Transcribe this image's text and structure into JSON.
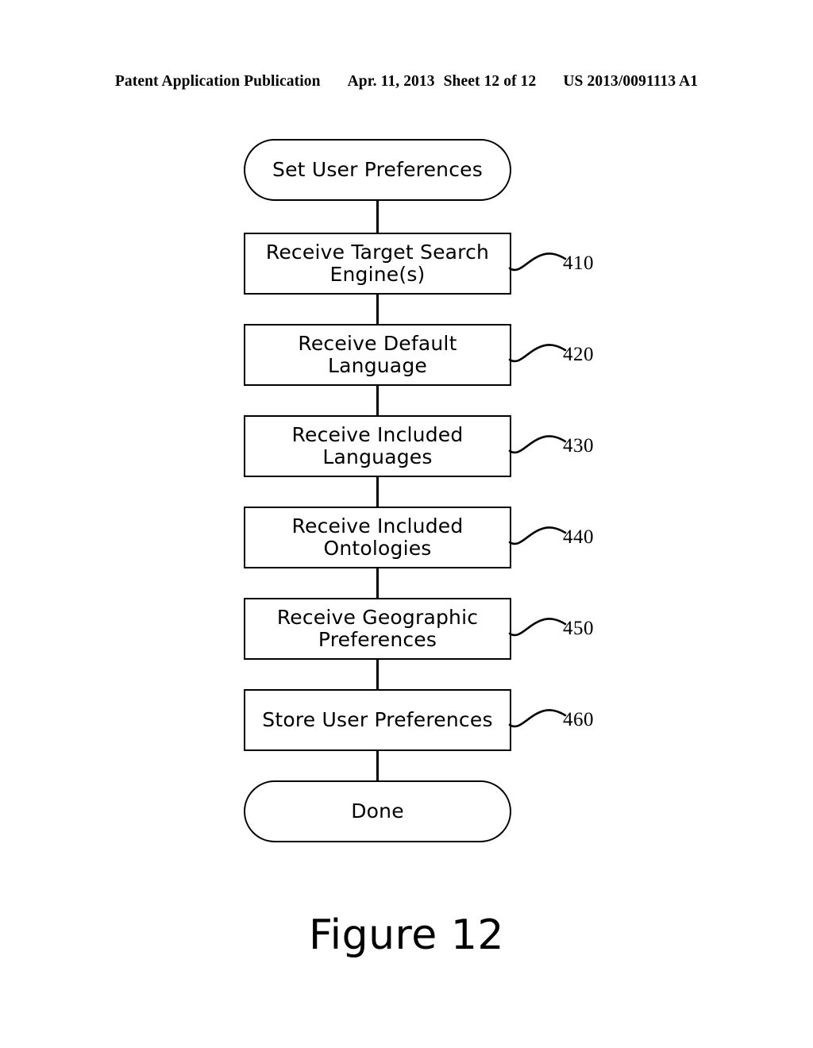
{
  "header": {
    "publication": "Patent Application Publication",
    "date": "Apr. 11, 2013",
    "sheet": "Sheet 12 of 12",
    "pub_number": "US 2013/0091113 A1"
  },
  "caption": "Figure 12",
  "colors": {
    "ink": "#000000",
    "paper": "#ffffff"
  },
  "chart_data": {
    "type": "diagram",
    "diagram_type": "flowchart",
    "title": "Figure 12",
    "orientation": "top-to-bottom",
    "nodes": [
      {
        "id": "start",
        "shape": "terminal",
        "label": "Set User Preferences",
        "ref": ""
      },
      {
        "id": "410",
        "shape": "process",
        "label": "Receive Target Search Engine(s)",
        "ref": "410"
      },
      {
        "id": "420",
        "shape": "process",
        "label": "Receive Default Language",
        "ref": "420"
      },
      {
        "id": "430",
        "shape": "process",
        "label": "Receive Included Languages",
        "ref": "430"
      },
      {
        "id": "440",
        "shape": "process",
        "label": "Receive Included Ontologies",
        "ref": "440"
      },
      {
        "id": "450",
        "shape": "process",
        "label": "Receive Geographic Preferences",
        "ref": "450"
      },
      {
        "id": "460",
        "shape": "process",
        "label": "Store User Preferences",
        "ref": "460"
      },
      {
        "id": "done",
        "shape": "terminal",
        "label": "Done",
        "ref": ""
      }
    ],
    "edges": [
      {
        "from": "start",
        "to": "410"
      },
      {
        "from": "410",
        "to": "420"
      },
      {
        "from": "420",
        "to": "430"
      },
      {
        "from": "430",
        "to": "440"
      },
      {
        "from": "440",
        "to": "450"
      },
      {
        "from": "450",
        "to": "460"
      },
      {
        "from": "460",
        "to": "done"
      }
    ],
    "reference_numerals": [
      "410",
      "420",
      "430",
      "440",
      "450",
      "460"
    ]
  },
  "nodes": {
    "n0": {
      "label": "Set User Preferences"
    },
    "n1": {
      "label": "Receive Target Search Engine(s)",
      "line1": "Receive Target Search",
      "line2": "Engine(s)",
      "ref": "410"
    },
    "n2": {
      "label": "Receive Default Language",
      "line1": "Receive Default",
      "line2": "Language",
      "ref": "420"
    },
    "n3": {
      "label": "Receive Included Languages",
      "line1": "Receive Included",
      "line2": "Languages",
      "ref": "430"
    },
    "n4": {
      "label": "Receive Included Ontologies",
      "line1": "Receive Included",
      "line2": "Ontologies",
      "ref": "440"
    },
    "n5": {
      "label": "Receive Geographic Preferences",
      "line1": "Receive Geographic",
      "line2": "Preferences",
      "ref": "450"
    },
    "n6": {
      "label": "Store User Preferences",
      "ref": "460"
    },
    "n7": {
      "label": "Done"
    }
  }
}
